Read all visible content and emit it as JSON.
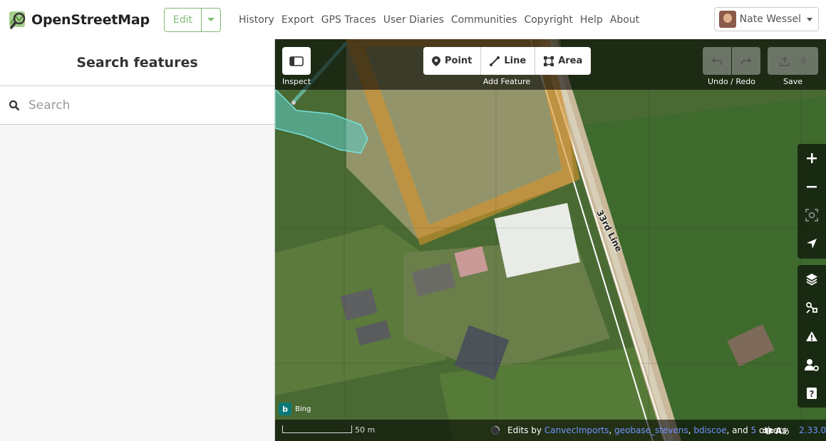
{
  "header": {
    "brand": "OpenStreetMap",
    "edit_label": "Edit",
    "nav": [
      "History",
      "Export",
      "GPS Traces",
      "User Diaries",
      "Communities",
      "Copyright",
      "Help",
      "About"
    ],
    "user_name": "Nate Wessel"
  },
  "sidebar": {
    "title": "Search features",
    "search_placeholder": "Search"
  },
  "map_toolbar": {
    "inspect_label": "Inspect",
    "add_feature_label": "Add Feature",
    "modes": [
      "Point",
      "Line",
      "Area"
    ],
    "undo_redo_label": "Undo / Redo",
    "save_label": "Save",
    "save_count": "0"
  },
  "map": {
    "road_label": "33rd Line",
    "imagery_provider": "Bing",
    "scale_label": "50 m",
    "attribution_prefix": "Edits by",
    "attribution_users": [
      "CanvecImports",
      "geobase_stevens",
      "bdiscoe"
    ],
    "attribution_and": "and",
    "attribution_others_count": "5",
    "attribution_others_label": "others",
    "version": "2.33.0"
  },
  "colors": {
    "osm_green": "#7ebc6f",
    "link_blue": "#7092ff",
    "area_orange": "#d9932a",
    "water_teal": "#5fc8c0"
  }
}
